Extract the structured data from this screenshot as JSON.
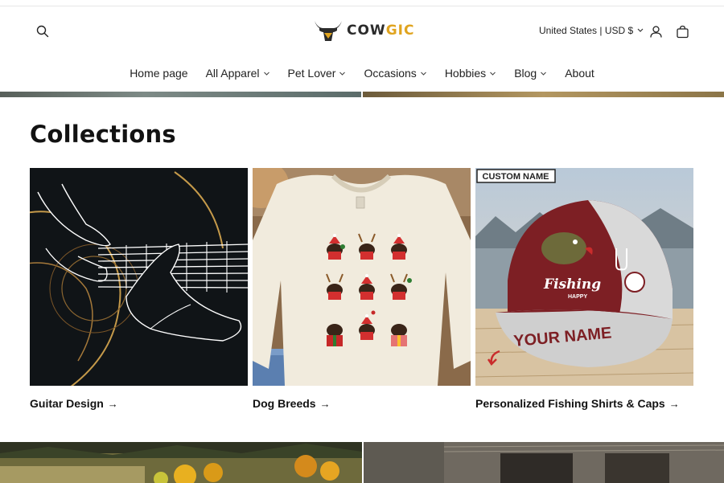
{
  "header": {
    "logo_text": "COWGIC",
    "logo_text_main": "COW",
    "logo_text_accent": "GIC",
    "locale": "United States | USD $",
    "icons": [
      "search-icon",
      "account-icon",
      "cart-icon"
    ]
  },
  "nav": {
    "items": [
      {
        "label": "Home page",
        "has_dropdown": false
      },
      {
        "label": "All Apparel",
        "has_dropdown": true
      },
      {
        "label": "Pet Lover",
        "has_dropdown": true
      },
      {
        "label": "Occasions",
        "has_dropdown": true
      },
      {
        "label": "Hobbies",
        "has_dropdown": true
      },
      {
        "label": "Blog",
        "has_dropdown": true
      },
      {
        "label": "About",
        "has_dropdown": false
      }
    ]
  },
  "collections": {
    "title": "Collections",
    "arrow": "→",
    "items": [
      {
        "label": "Guitar Design"
      },
      {
        "label": "Dog Breeds"
      },
      {
        "label": "Personalized Fishing Shirts & Caps",
        "badge": "CUSTOM NAME",
        "cap_text": "Fishing",
        "cap_subtext": "HAPPY",
        "cap_name": "YOUR NAME"
      }
    ]
  },
  "colors": {
    "accent": "#e0a41f",
    "text": "#121212",
    "background": "#ffffff"
  }
}
